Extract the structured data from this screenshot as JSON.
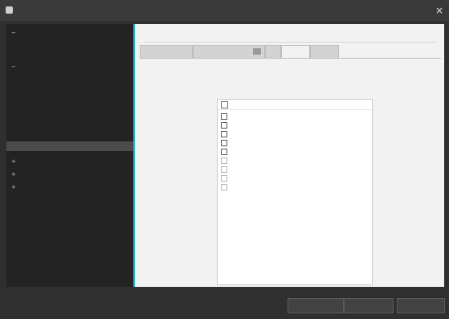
{
  "window": {
    "title": ""
  },
  "sidebar": {
    "items": [
      {
        "label": "",
        "expanded": true
      },
      {
        "label": ""
      },
      {
        "label": ""
      },
      {
        "label": "",
        "expanded": true
      },
      {
        "label": ""
      },
      {
        "label": ""
      },
      {
        "label": ""
      },
      {
        "label": ""
      },
      {
        "label": ""
      },
      {
        "label": "",
        "selected": true
      },
      {
        "label": "",
        "expanded": false
      },
      {
        "label": "",
        "expanded": false
      },
      {
        "label": "",
        "expanded": false
      }
    ]
  },
  "content": {
    "section_title": "",
    "tabs": [
      {
        "label": ""
      },
      {
        "label": ""
      },
      {
        "label": ""
      },
      {
        "label": ""
      },
      {
        "label": ""
      }
    ],
    "list": {
      "header_label": "",
      "rows": [
        {
          "checked": false
        },
        {
          "checked": false
        },
        {
          "checked": false
        },
        {
          "checked": false
        },
        {
          "checked": false
        },
        {
          "checked": false
        },
        {
          "checked": false
        },
        {
          "checked": false
        },
        {
          "checked": false
        }
      ]
    },
    "pane_button_label": ""
  },
  "footer": {
    "buttons": [
      {
        "label": ""
      },
      {
        "label": ""
      },
      {
        "label": ""
      }
    ]
  },
  "colors": {
    "accent": "#1fbac4",
    "window_background": "#2f2f2f",
    "sidebar_background": "#232323",
    "content_background": "#f2f2f2",
    "section_title": "#1f8fc1"
  }
}
